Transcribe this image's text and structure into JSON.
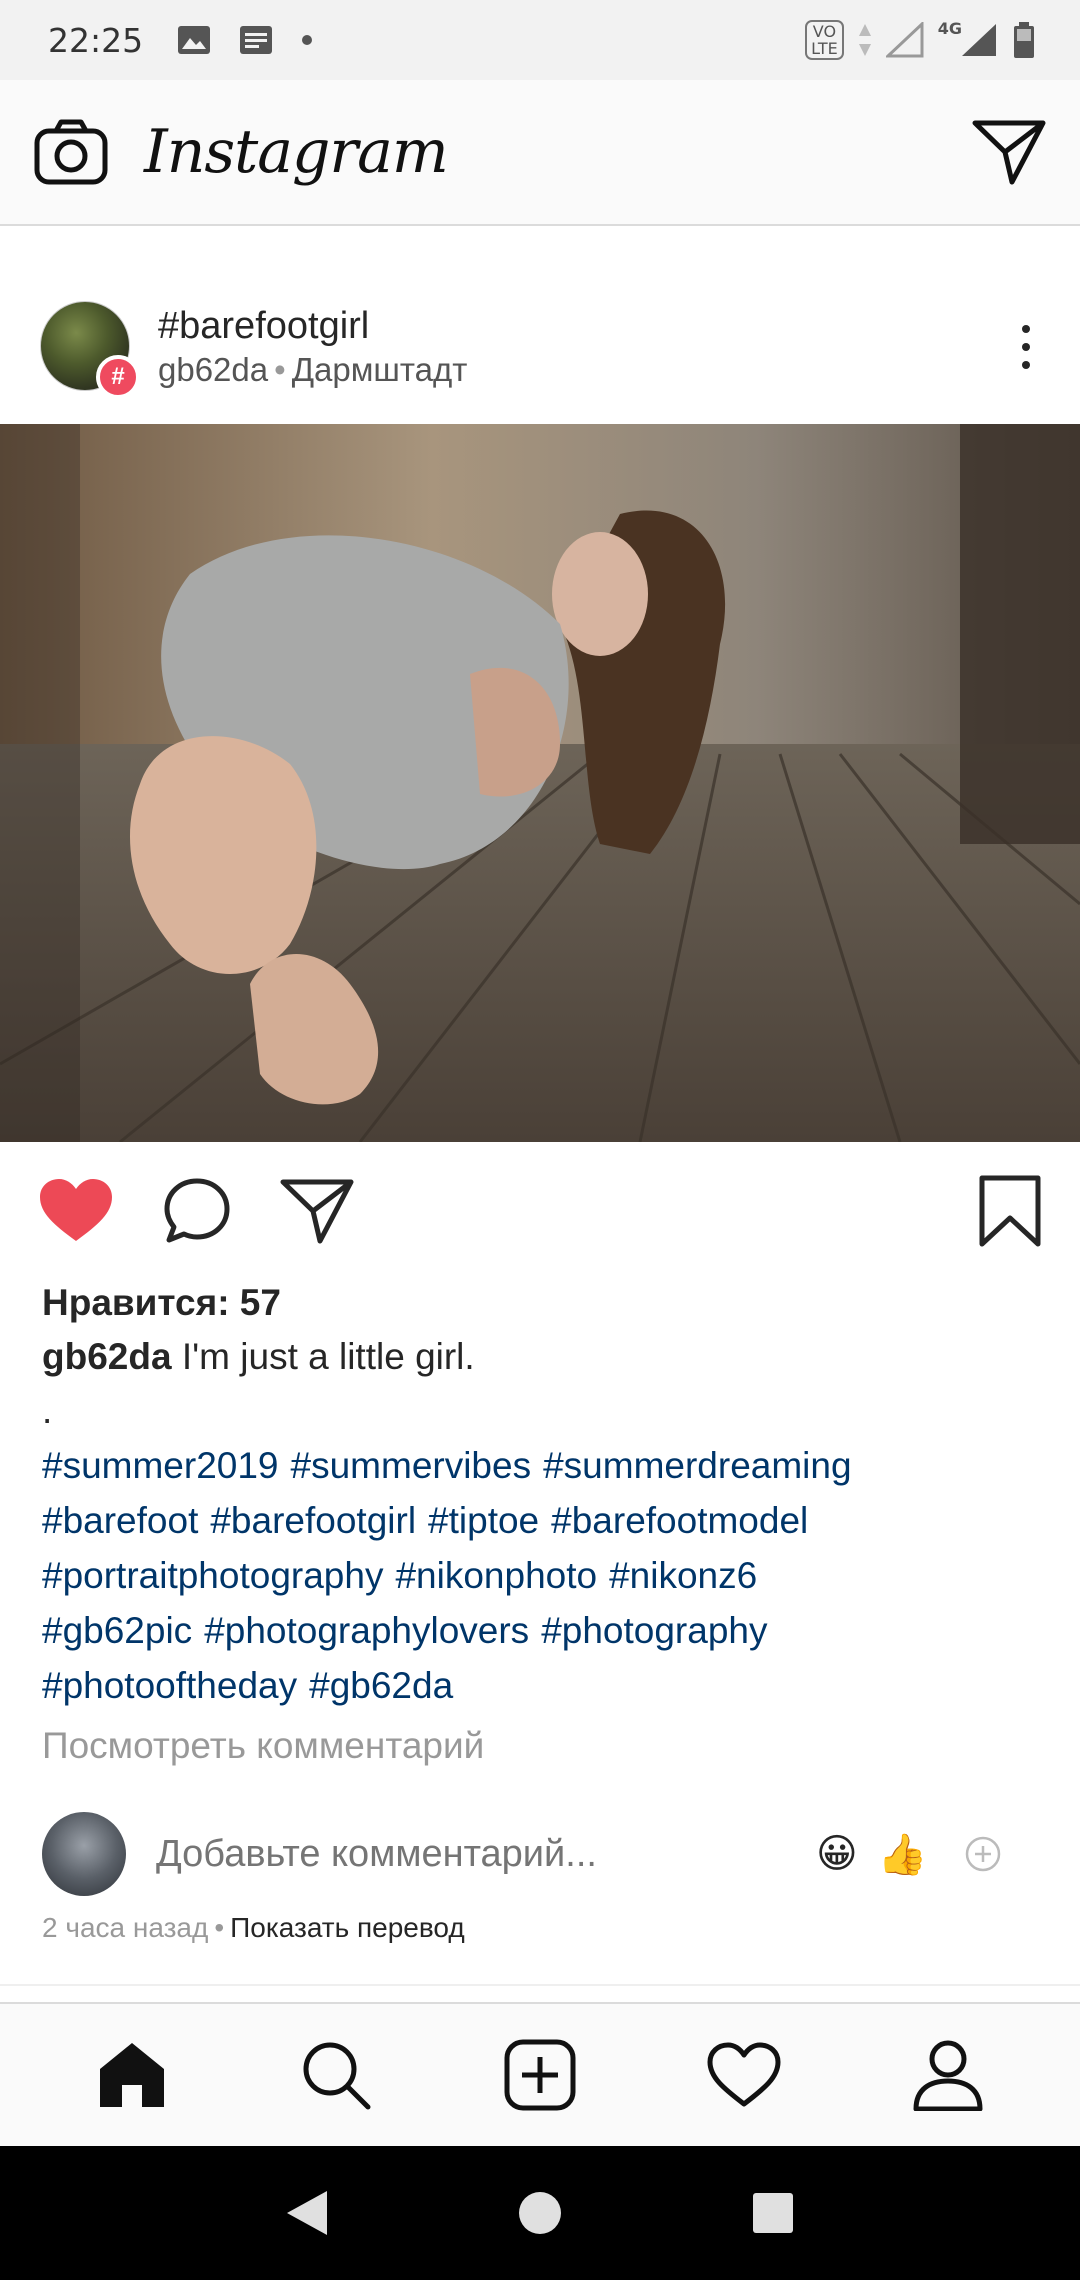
{
  "status_bar": {
    "time": "22:25",
    "volte_label": "VO\nLTE",
    "network_type": "4G"
  },
  "header": {
    "logo_text": "Instagram"
  },
  "post": {
    "title": "#barefootgirl",
    "username": "gb62da",
    "separator": "•",
    "location": "Дармштадт",
    "badge_symbol": "#"
  },
  "actions": {
    "liked": true,
    "like_color": "#ed4956"
  },
  "caption": {
    "likes_text": "Нравится: 57",
    "username": "gb62da",
    "text": "I'm just a little girl.",
    "dot_line": ".",
    "hashtags": [
      "#summer2019",
      "#summervibes",
      "#summerdreaming",
      "#barefoot",
      "#barefootgirl",
      "#tiptoe",
      "#barefootmodel",
      "#portraitphotography",
      "#nikonphoto",
      "#nikonz6",
      "#gb62pic",
      "#photographylovers",
      "#photography",
      "#photooftheday",
      "#gb62da"
    ],
    "view_comments": "Посмотреть комментарий"
  },
  "comment": {
    "placeholder": "Добавьте комментарий...",
    "emoji_1": "😀",
    "emoji_2": "👍"
  },
  "footer_meta": {
    "time_ago": "2 часа назад",
    "separator": "•",
    "translate": "Показать перевод"
  },
  "colors": {
    "hashtag": "#003569",
    "like_red": "#ed4956",
    "hash_badge": "#ef4a5f"
  }
}
